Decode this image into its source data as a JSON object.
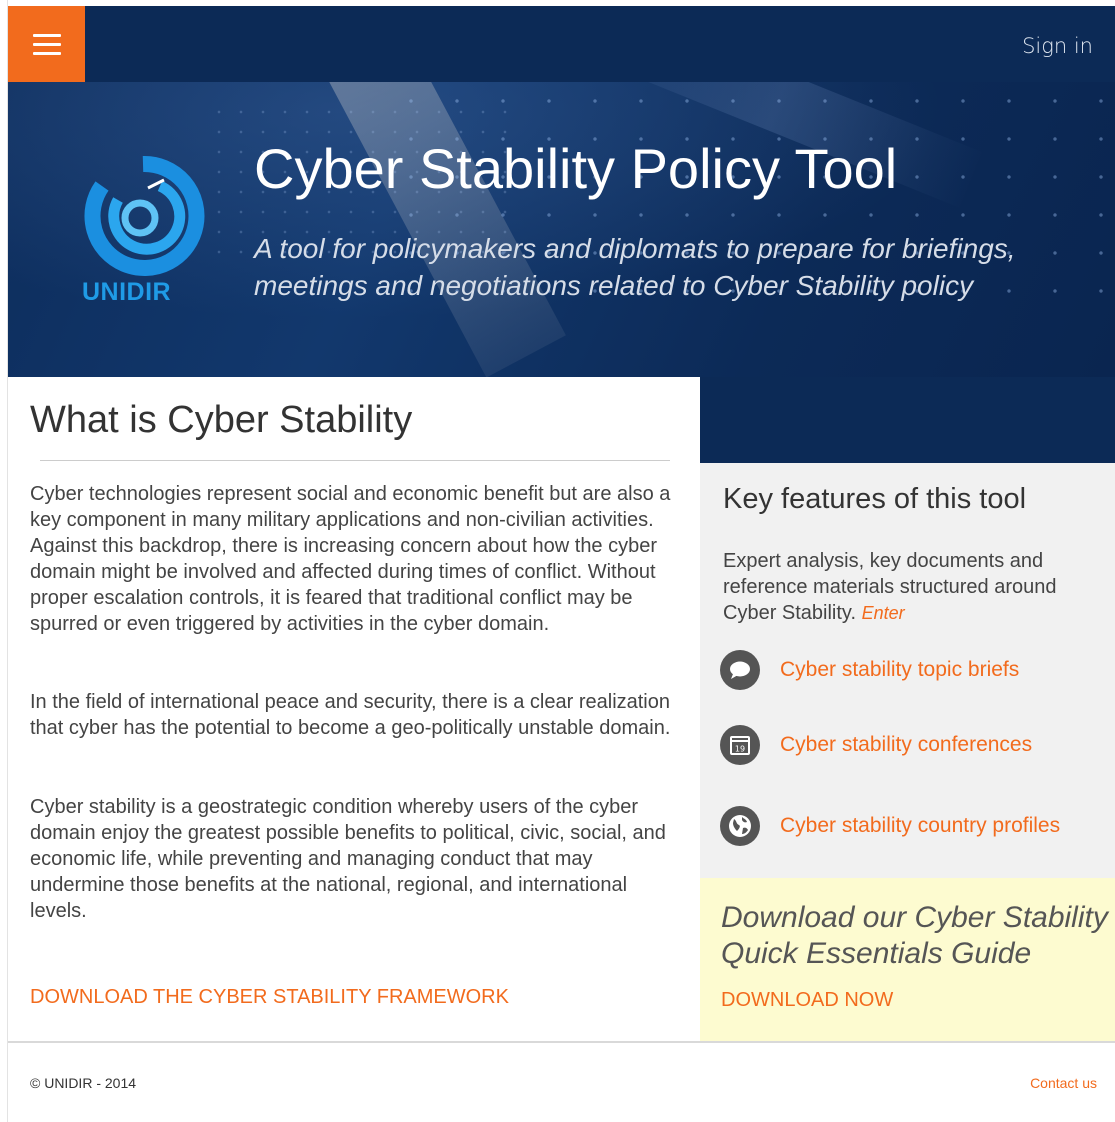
{
  "topbar": {
    "menu_icon": "hamburger-menu-icon",
    "signin_label": "Sign in"
  },
  "hero": {
    "logo_text": "UNIDIR",
    "title": "Cyber Stability Policy Tool",
    "subtitle": "A tool for policymakers and diplomats to prepare for briefings, meetings and negotiations related to Cyber Stability policy"
  },
  "main": {
    "heading": "What is Cyber Stability",
    "paragraphs": [
      "Cyber technologies represent social and economic benefit but are also a key component in many military applications and non-civilian activities. Against this backdrop, there is increasing concern about how the cyber domain might be involved and affected during times of conflict. Without proper escalation controls, it is feared that traditional conflict may be spurred or even triggered by activities in the cyber domain.",
      "In the field of international peace and security, there is a clear realization that cyber has the potential to become a geo-politically unstable domain.",
      "Cyber stability is a geostrategic condition whereby users of the cyber domain enjoy the greatest possible benefits to political, civic, social, and economic life, while preventing and managing conduct that may undermine those benefits at the national, regional, and international levels."
    ],
    "download_framework_label": "DOWNLOAD THE CYBER STABILITY FRAMEWORK"
  },
  "features": {
    "heading": "Key features of this tool",
    "intro": "Expert analysis, key documents and reference materials structured around Cyber Stability.",
    "enter_label": "Enter",
    "items": [
      {
        "icon": "speech-bubble-icon",
        "label": "Cyber stability topic briefs"
      },
      {
        "icon": "calendar-icon",
        "label": "Cyber stability conferences",
        "icon_text": "19"
      },
      {
        "icon": "globe-icon",
        "label": "Cyber stability country profiles"
      }
    ]
  },
  "guide": {
    "title": "Download our Cyber Stability Quick Essentials Guide",
    "download_label": "DOWNLOAD NOW"
  },
  "footer": {
    "copyright": "© UNIDIR - 2014",
    "contact_label": "Contact us"
  },
  "colors": {
    "navy": "#0c2a56",
    "orange": "#f26b1d",
    "logo_blue": "#1f9be6",
    "guide_bg": "#fdfbd0",
    "features_bg": "#f1f1f1"
  }
}
